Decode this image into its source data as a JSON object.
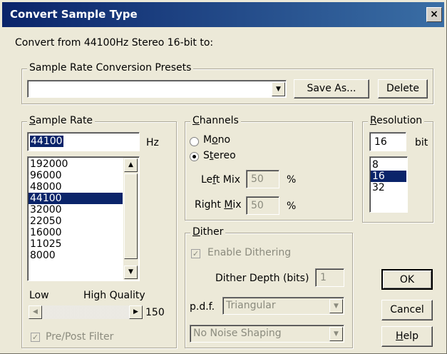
{
  "window": {
    "title": "Convert Sample Type",
    "close_label": "×"
  },
  "intro_text": "Convert from 44100Hz Stereo 16-bit to:",
  "presets": {
    "group_label": "Sample Rate Conversion Presets",
    "selected_value": "",
    "save_as_label": "Save As...",
    "delete_label": "Delete"
  },
  "sample_rate": {
    "group_label": "Sample Rate",
    "value": "44100",
    "unit": "Hz",
    "options": [
      "192000",
      "96000",
      "48000",
      "44100",
      "32000",
      "22050",
      "16000",
      "11025",
      "8000"
    ],
    "selected_index": 3,
    "quality_low_label": "Low",
    "quality_high_label": "High Quality",
    "quality_value": "150",
    "pre_post_filter_label": "Pre/Post Filter",
    "pre_post_filter_checked": true
  },
  "channels": {
    "group_label": "Channels",
    "mono_label": "Mono",
    "stereo_label": "Stereo",
    "selected": "Stereo",
    "left_mix_label": "Left Mix",
    "left_mix_value": "50",
    "right_mix_label": "Right Mix",
    "right_mix_value": "50",
    "percent": "%"
  },
  "dither": {
    "group_label": "Dither",
    "enable_label": "Enable Dithering",
    "enable_checked": true,
    "depth_label": "Dither Depth (bits)",
    "depth_value": "1",
    "pdf_label": "p.d.f.",
    "pdf_value": "Triangular",
    "noise_shaping_value": "No Noise Shaping"
  },
  "resolution": {
    "group_label": "Resolution",
    "value": "16",
    "unit": "bit",
    "options": [
      "8",
      "16",
      "32"
    ],
    "selected_index": 1
  },
  "buttons": {
    "ok": "OK",
    "cancel": "Cancel",
    "help": "Help"
  }
}
